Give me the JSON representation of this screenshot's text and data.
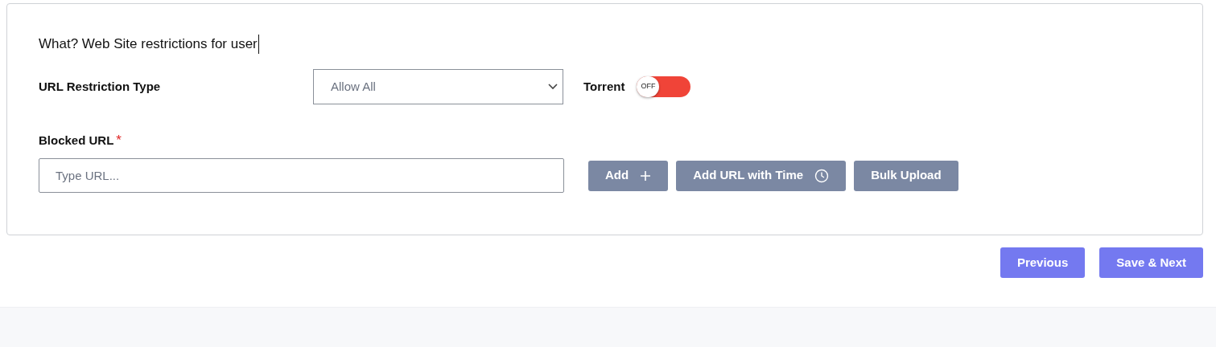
{
  "heading": "What? Web Site restrictions for user",
  "restriction": {
    "label": "URL Restriction Type",
    "value": "Allow All"
  },
  "torrent": {
    "label": "Torrent",
    "on": false,
    "state_text": "OFF"
  },
  "blocked_url": {
    "label": "Blocked URL",
    "required_mark": "*",
    "placeholder": "Type URL..."
  },
  "url_buttons": [
    {
      "label": "Add",
      "kind": "plus"
    },
    {
      "label": "Add URL with Time",
      "kind": "clock"
    },
    {
      "label": "Bulk Upload",
      "kind": "plain"
    }
  ],
  "nav_buttons": [
    "Previous",
    "Save & Next"
  ]
}
